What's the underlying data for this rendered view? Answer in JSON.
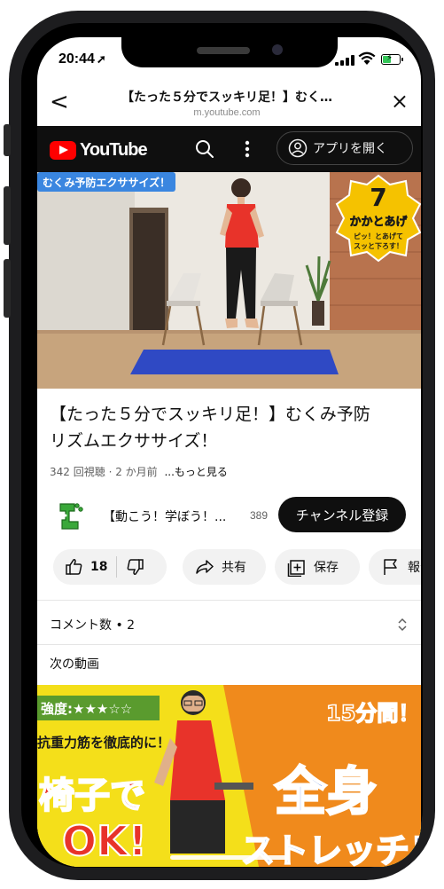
{
  "status": {
    "time": "20:44"
  },
  "browser": {
    "back_glyph": "<",
    "title": "【たった５分でスッキリ足！】むく…",
    "url": "m.youtube.com",
    "close_glyph": "×"
  },
  "youtube": {
    "logo_text": "YouTube",
    "open_app_label": "アプリを開く"
  },
  "video": {
    "badge": "むくみ予防エクササイズ！",
    "step_number": "7",
    "step_title": "かかとあげ",
    "step_sub1": "ピッ！とあげて",
    "step_sub2": "スッと下ろす！",
    "title_line1": "【たった５分でスッキリ足！】むくみ予防",
    "title_line2": "リズムエクササイズ！",
    "views": "342 回視聴",
    "age": "2 か月前",
    "more_label": "...もっと見る"
  },
  "channel": {
    "name": "【動こう！学ぼう！...",
    "subscribers": "389",
    "subscribe_label": "チャンネル登録"
  },
  "actions": {
    "like_count": "18",
    "share_label": "共有",
    "save_label": "保存",
    "report_label": "報告"
  },
  "comments": {
    "label": "コメント数 • 2"
  },
  "next": {
    "label": "次の動画",
    "thumb_intensity": "強度:★★★☆☆",
    "thumb_line": "抗重力筋を徹底的に！",
    "thumb_minutes": "15分間！",
    "thumb_chair": "椅子で",
    "thumb_ok": "OK!",
    "thumb_whole": "全身",
    "thumb_stretch": "ストレッチ！"
  },
  "colors": {
    "yt_red": "#ff0000",
    "yt_dark": "#0f0f0f",
    "thumb_yellow": "#f4df1a",
    "thumb_blue": "#1f5ad8",
    "thumb_orange": "#f08a1c",
    "badge_blue": "#3a86e0",
    "shirt_red": "#e8332a",
    "mat_blue": "#2f49c4"
  }
}
